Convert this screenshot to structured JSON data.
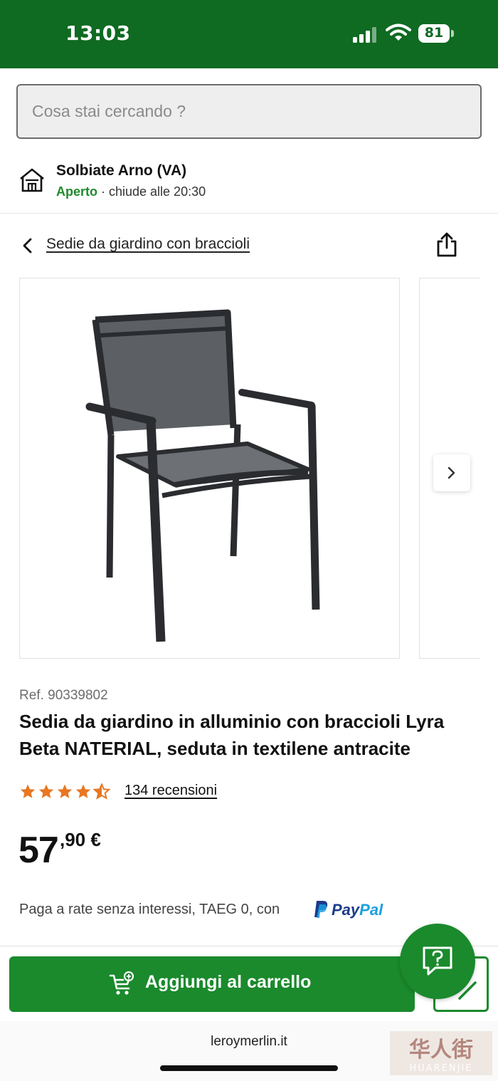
{
  "status_bar": {
    "time": "13:03",
    "battery": "81",
    "icons": [
      "cellular-signal-icon",
      "wifi-icon",
      "battery-icon"
    ],
    "color": "#0f6a22"
  },
  "search": {
    "placeholder": "Cosa stai cercando ?"
  },
  "store": {
    "name": "Solbiate Arno (VA)",
    "open_label": "Aperto",
    "hours": " · chiude alle 20:30",
    "icon": "store-icon"
  },
  "breadcrumb": {
    "label": "Sedie da giardino con braccioli",
    "back_icon": "chevron-left-icon",
    "share_icon": "share-icon"
  },
  "product": {
    "ref": "Ref. 90339802",
    "title": "Sedia da giardino in alluminio con braccioli Lyra Beta NATERIAL, seduta in textilene antracite",
    "rating": 4.5,
    "reviews": "134 recensioni",
    "price_int": "57",
    "price_dec": ",90 €",
    "installments": "Paga a rate senza interessi, TAEG 0, con",
    "paypal": {
      "pay": "Pay",
      "pal": "Pal"
    }
  },
  "actions": {
    "add_to_cart": "Aggiungi al carrello",
    "accent": "#1a8a2c"
  },
  "browser": {
    "url": "leroymerlin.it"
  },
  "watermark": {
    "text": "华人街",
    "sub": "HUARENJIE"
  }
}
